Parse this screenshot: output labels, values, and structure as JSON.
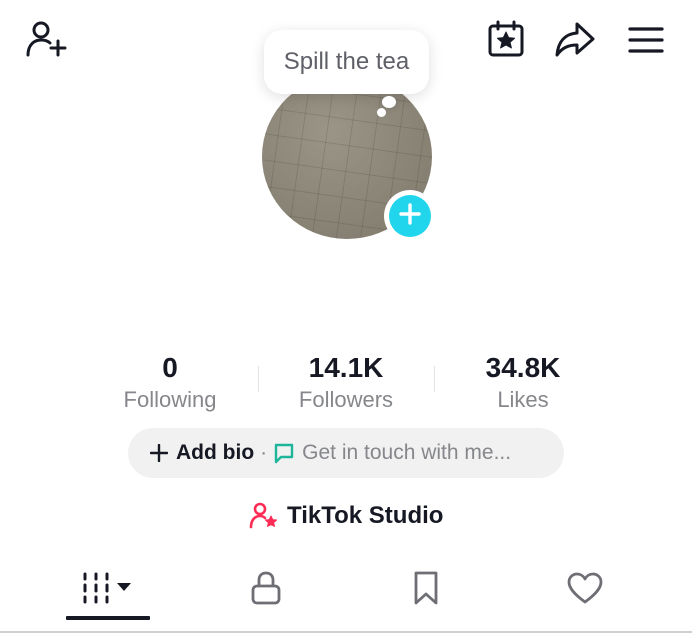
{
  "header": {
    "add_friend_icon": "person-plus-icon",
    "calendar_icon": "calendar-star-icon",
    "share_icon": "share-arrow-icon",
    "menu_icon": "hamburger-menu-icon"
  },
  "tooltip": {
    "text": "Spill the tea"
  },
  "avatar": {
    "add_icon": "plus-icon",
    "accent": "#20d5ec"
  },
  "stats": [
    {
      "value": "0",
      "label": "Following"
    },
    {
      "value": "14.1K",
      "label": "Followers"
    },
    {
      "value": "34.8K",
      "label": "Likes"
    }
  ],
  "bio": {
    "add_bio_label": "Add bio",
    "separator": "·",
    "contact_label": "Get in touch with me...",
    "contact_icon_color": "#1fb59a"
  },
  "studio": {
    "label": "TikTok Studio",
    "icon_color": "#fe2c55"
  },
  "tabs": [
    {
      "name": "videos",
      "icon": "grid-bars-icon",
      "active": true
    },
    {
      "name": "private",
      "icon": "lock-icon",
      "active": false
    },
    {
      "name": "favorites",
      "icon": "bookmark-icon",
      "active": false
    },
    {
      "name": "liked",
      "icon": "heart-icon",
      "active": false
    }
  ]
}
